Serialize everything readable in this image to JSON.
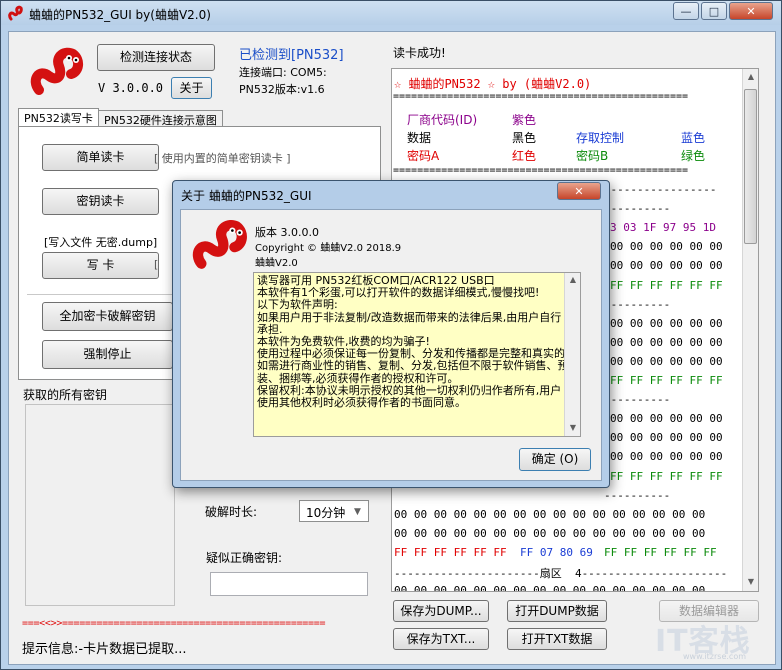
{
  "window": {
    "title": "蛐蛐的PN532_GUI by(蛐蛐V2.0)",
    "controls": {
      "minimize": "—",
      "maximize": "□",
      "close": "✕"
    }
  },
  "top": {
    "check_btn": "检测连接状态",
    "version": "V 3.0.0.0",
    "about_btn": "关于",
    "detected": "已检测到[PN532]",
    "port": "连接端口: COM5:",
    "pn532_version": "PN532版本:v1.6",
    "read_ok": "读卡成功!"
  },
  "tabs": [
    "PN532读写卡",
    "PN532硬件连接示意图"
  ],
  "left": {
    "simple_read": "简单读卡",
    "simple_read_hint": "[ 使用内置的简单密钥读卡 ]",
    "key_read": "密钥读卡",
    "write_file": "[写入文件 无密.dump]",
    "write_card": "写 卡",
    "crack": "全加密卡破解密钥",
    "force_stop": "强制停止",
    "keys_label": "获取的所有密钥",
    "crack_time_label": "破解时长:",
    "crack_time_value": "10分钟",
    "suspect_key_label": "疑似正确密钥:",
    "separator": "===<<>>==============================================",
    "status": "提示信息:-卡片数据已提取..."
  },
  "dump": {
    "header": "☆ 蛐蛐的PN532 ☆ by (蛐蛐V2.0)",
    "eq_line": "=================================================",
    "legend": [
      [
        "厂商代码(ID)",
        "紫色",
        "",
        ""
      ],
      [
        "数据",
        "黑色",
        "存取控制",
        "蓝色"
      ],
      [
        "密码A",
        "红色",
        "密码B",
        "绿色"
      ]
    ],
    "colors": {
      "purple": "#8b008b",
      "red": "#e00000",
      "blue": "#1a3cd4",
      "green": "#0a8a0a"
    },
    "rows": [
      {
        "type": "dash"
      },
      {
        "type": "dash_partial"
      },
      {
        "type": "mfr",
        "text": "3 03 1F 97 95 1D"
      },
      {
        "type": "data",
        "text": "00 00 00 00 00 00"
      },
      {
        "type": "data",
        "text": "00 00 00 00 00 00"
      },
      {
        "type": "trailerB",
        "text": "FF FF FF FF FF FF"
      },
      {
        "type": "dash_partial"
      },
      {
        "type": "data",
        "text": "00 00 00 00 00 00"
      },
      {
        "type": "data",
        "text": "00 00 00 00 00 00"
      },
      {
        "type": "data",
        "text": "00 00 00 00 00 00"
      },
      {
        "type": "trailerB",
        "text": "FF FF FF FF FF FF"
      },
      {
        "type": "dash_partial"
      },
      {
        "type": "data",
        "text": "00 00 00 00 00 00"
      },
      {
        "type": "data",
        "text": "00 00 00 00 00 00"
      },
      {
        "type": "data",
        "text": "00 00 00 00 00 00"
      },
      {
        "type": "trailerB",
        "text": "FF FF FF FF FF FF"
      },
      {
        "type": "dash_partial"
      },
      {
        "type": "data_full",
        "text": "00 00 00 00 00 00 00 00 00 00 00 00 00 00 00 00"
      },
      {
        "type": "data_full",
        "text": "00 00 00 00 00 00 00 00 00 00 00 00 00 00 00 00"
      },
      {
        "type": "trailer_full",
        "a": "FF FF FF FF FF FF ",
        "ac": "FF 07 80 69 ",
        "b": "FF FF FF FF FF FF"
      },
      {
        "type": "sector",
        "text": "----------------------扇区  4----------------------"
      },
      {
        "type": "data_full",
        "text": "00 00 00 00 00 00 00 00 00 00 00 00 00 00 00 00"
      },
      {
        "type": "data_full",
        "text": "00 00 00 00 00 00 00 00 00 00 00 00 00 00 00 00"
      }
    ]
  },
  "bottom_buttons": {
    "save_dump": "保存为DUMP...",
    "open_dump": "打开DUMP数据",
    "data_editor": "数据编辑器",
    "save_txt": "保存为TXT...",
    "open_txt": "打开TXT数据"
  },
  "watermark": "IT客栈",
  "watermark_sub": "www.itzrse.com",
  "about": {
    "title": "关于 蛐蛐的PN532_GUI",
    "version": "版本 3.0.0.0",
    "copyright": "Copyright © 蛐蛐V2.0 2018.9",
    "author": "蛐蛐V2.0",
    "lines": [
      "读写器可用 PN532红板COM口/ACR122 USB口",
      "本软件有1个彩蛋,可以打开软件的数据详细模式,慢慢找吧!",
      "以下为软件声明:",
      "如果用户用于非法复制/改造数据而带来的法律后果,由用户自行承担.",
      "本软件为免费软件,收费的均为骗子!",
      "使用过程中必须保证每一份复制、分发和传播都是完整和真实的.",
      "如需进行商业性的销售、复制、分发,包括但不限于软件销售、预装、捆绑等,必须获得作者的授权和许可。",
      "保留权利:本协议未明示授权的其他一切权利仍归作者所有,用户使用其他权利时必须获得作者的书面同意。"
    ],
    "ok": "确定 (O)",
    "close": "✕"
  }
}
